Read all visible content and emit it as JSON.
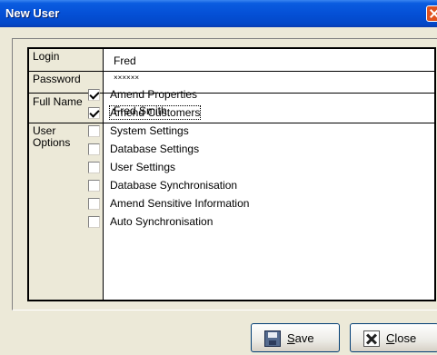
{
  "window": {
    "title": "New User"
  },
  "form": {
    "login_label": "Login",
    "login_value": "Fred",
    "password_label": "Password",
    "password_value": "××××××",
    "fullname_label": "Full Name",
    "fullname_value": "Fred Smith",
    "options_label": "User Options",
    "options": [
      {
        "label": "Amend Properties",
        "checked": true
      },
      {
        "label": "Amend Customers",
        "checked": true
      },
      {
        "label": "System Settings",
        "checked": false
      },
      {
        "label": "Database Settings",
        "checked": false
      },
      {
        "label": "User Settings",
        "checked": false
      },
      {
        "label": "Database Synchronisation",
        "checked": false
      },
      {
        "label": "Amend Sensitive Information",
        "checked": false
      },
      {
        "label": "Auto Synchronisation",
        "checked": false
      }
    ]
  },
  "buttons": {
    "save_first": "S",
    "save_rest": "ave",
    "close_first": "C",
    "close_rest": "lose"
  }
}
